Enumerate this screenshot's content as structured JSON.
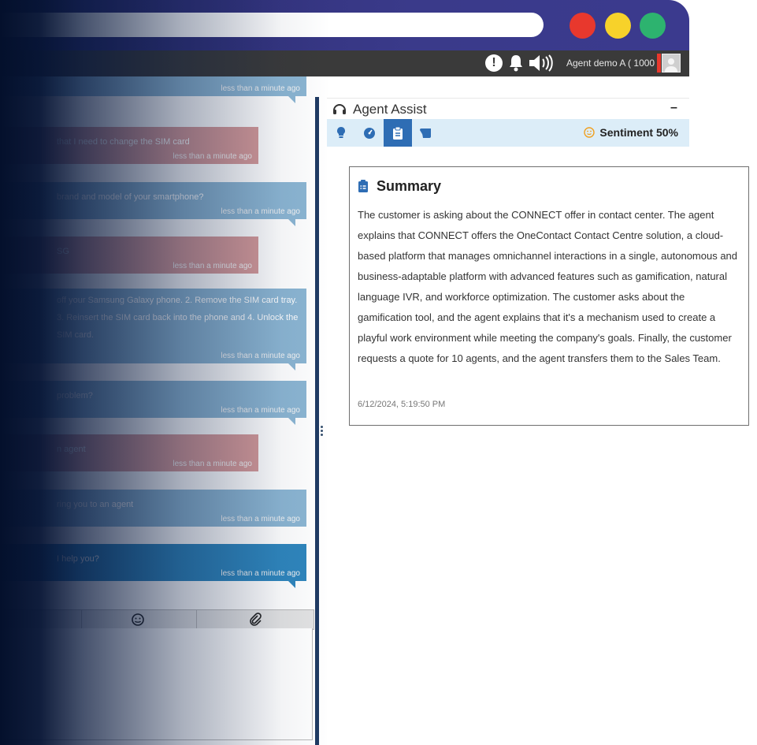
{
  "window": {
    "controls": [
      "close",
      "minimize",
      "maximize"
    ],
    "colors": {
      "close": "#e8382d",
      "minimize": "#f7d22a",
      "maximize": "#2db36f"
    }
  },
  "toolbar": {
    "agent_label": "Agent demo A ( 1000 )",
    "icons": [
      "alert-icon",
      "bell-icon",
      "speaker-icon",
      "avatar"
    ]
  },
  "chat": {
    "messages": [
      {
        "sender": "customer",
        "text": "that I need to change the SIM card",
        "time": "less than a minute ago"
      },
      {
        "sender": "agent",
        "text": "brand and model of your smartphone?",
        "time": "less than a minute ago"
      },
      {
        "sender": "customer",
        "text": "SG",
        "time": "less than a minute ago"
      },
      {
        "sender": "agent",
        "text": "off your Samsung Galaxy phone. 2. Remove the SIM card tray. 3. Reinsert the SIM card back into the phone and 4. Unlock the SIM card.",
        "time": "less than a minute ago"
      },
      {
        "sender": "agent",
        "text": "problem?",
        "time": "less than a minute ago"
      },
      {
        "sender": "customer",
        "text": "n agent",
        "time": "less than a minute ago"
      },
      {
        "sender": "agent",
        "text": "ring you to an agent",
        "time": "less than a minute ago"
      },
      {
        "sender": "agent",
        "text": "I help you?",
        "time": "less than a minute ago"
      }
    ],
    "partial_time": "less than a minute ago",
    "composer_icons": [
      "emoji-icon",
      "paperclip-icon"
    ]
  },
  "assist": {
    "title": "Agent Assist",
    "minimize_label": "–",
    "tabs": [
      "lightbulb-icon",
      "dashboard-icon",
      "clipboard-icon",
      "scroll-icon"
    ],
    "active_tab": 2,
    "sentiment_label": "Sentiment 50%",
    "sentiment_value": 50
  },
  "summary": {
    "title": "Summary",
    "text": "The customer is asking about the CONNECT offer in contact center. The agent explains that CONNECT offers the OneContact Contact Centre solution, a cloud-based platform that manages omnichannel interactions in a single, autonomous and business-adaptable platform with advanced features such as gamification, natural language IVR, and workforce optimization. The customer asks about the gamification tool, and the agent explains that it's a mechanism used to create a playful work environment while meeting the company's goals. Finally, the customer requests a quote for 10 agents, and the agent transfers them to the Sales Team.",
    "date": "6/12/2024, 5:19:50 PM"
  },
  "colors": {
    "banner": "#3a3a8a",
    "toolbar": "#3a3a3a",
    "agent_bubble": "#8cb6d3",
    "customer_bubble": "#d59a9a",
    "active_bubble": "#2f86bd",
    "tab_bar": "#dcedf8",
    "active_tab": "#2e6db4"
  }
}
